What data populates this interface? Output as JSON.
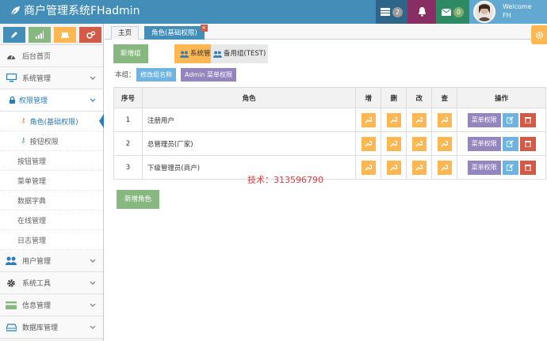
{
  "app": {
    "title": "商户管理系统FHadmin"
  },
  "topbar": {
    "messages_count": "2",
    "mail_count": "0",
    "user": {
      "welcome": "Welcome",
      "name": "FH"
    },
    "colors": {
      "bar": "#438eb9",
      "messages": "#2e6589",
      "bell": "#892e65",
      "mail": "#2e8965",
      "user": "#62a8d1"
    }
  },
  "sidebar": {
    "shortcuts": [
      {
        "icon": "pencil-icon",
        "color": "#438eb9"
      },
      {
        "icon": "signal-icon",
        "color": "#87b87f"
      },
      {
        "icon": "users-icon",
        "color": "#ffb752"
      },
      {
        "icon": "cogs-icon",
        "color": "#d15b47"
      }
    ],
    "items": [
      {
        "label": "后台首页",
        "icon": "dashboard-icon"
      },
      {
        "label": "系统管理",
        "icon": "desktop-icon"
      },
      {
        "label": "权限管理",
        "icon": "lock-icon"
      },
      {
        "label": "角色(基础权限)"
      },
      {
        "label": "按钮权限"
      },
      {
        "label": "按钮管理"
      },
      {
        "label": "菜单管理"
      },
      {
        "label": "数据字典"
      },
      {
        "label": "在线管理"
      },
      {
        "label": "日志管理"
      },
      {
        "label": "用户管理",
        "icon": "users-icon"
      },
      {
        "label": "系统工具",
        "icon": "cog-icon"
      },
      {
        "label": "信息管理",
        "icon": "credit-card-icon"
      },
      {
        "label": "数据库管理",
        "icon": "hdd-icon"
      }
    ]
  },
  "tabs": [
    {
      "label": "主页"
    },
    {
      "label": "角色(基础权限)",
      "close": "×"
    }
  ],
  "toolbar": {
    "add_group": "新增组",
    "group_system": "系统管理组",
    "group_backup": "备用组(TEST)"
  },
  "group": {
    "label": "本组：",
    "rename": "修改组名称",
    "admin_menu": "Admin 菜单权限"
  },
  "table": {
    "headers": [
      "序号",
      "角色",
      "增",
      "删",
      "改",
      "查",
      "操作"
    ],
    "rows": [
      {
        "no": "1",
        "role": "注册用户",
        "menu": "菜单权限"
      },
      {
        "no": "2",
        "role": "总管理员(厂家)",
        "menu": "菜单权限"
      },
      {
        "no": "3",
        "role": "下级管理员(商户)",
        "menu": "菜单权限"
      }
    ]
  },
  "watermark": "技术：313596790",
  "add_role": "新增角色"
}
